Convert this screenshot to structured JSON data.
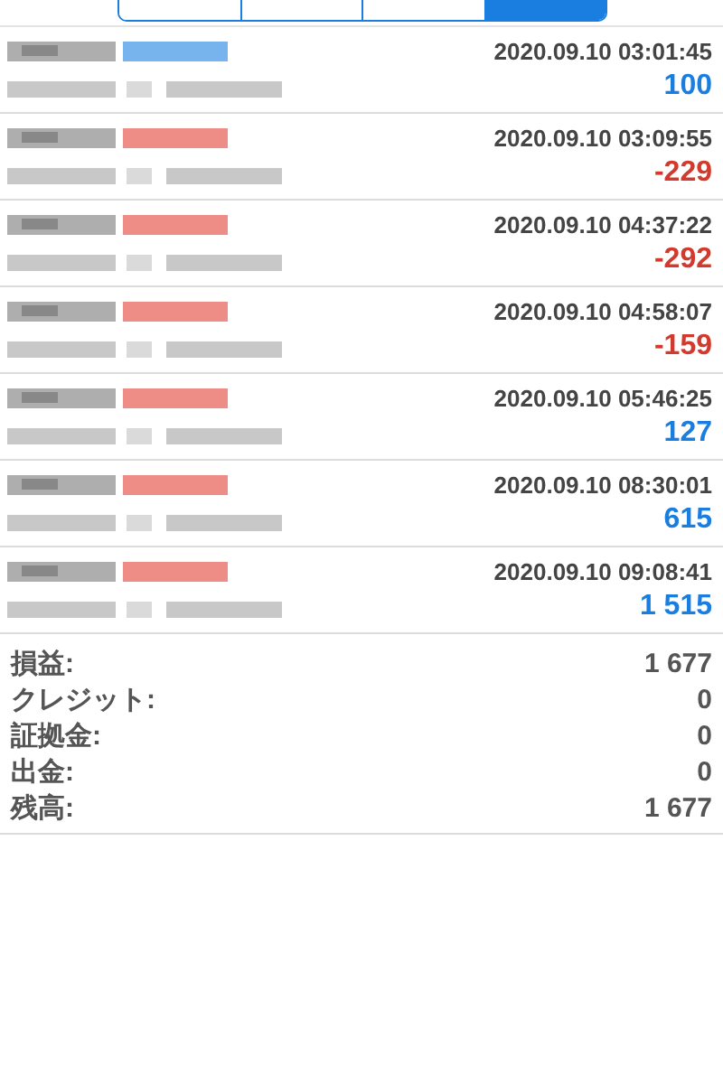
{
  "tabs": [
    {
      "selected": false
    },
    {
      "selected": false
    },
    {
      "selected": false
    },
    {
      "selected": true
    }
  ],
  "deals": [
    {
      "kind": "buy",
      "time": "2020.09.10 03:01:45",
      "profit": "100",
      "positive": true
    },
    {
      "kind": "sell",
      "time": "2020.09.10 03:09:55",
      "profit": "-229",
      "positive": false
    },
    {
      "kind": "sell",
      "time": "2020.09.10 04:37:22",
      "profit": "-292",
      "positive": false
    },
    {
      "kind": "sell",
      "time": "2020.09.10 04:58:07",
      "profit": "-159",
      "positive": false
    },
    {
      "kind": "sell",
      "time": "2020.09.10 05:46:25",
      "profit": "127",
      "positive": true
    },
    {
      "kind": "sell",
      "time": "2020.09.10 08:30:01",
      "profit": "615",
      "positive": true
    },
    {
      "kind": "sell",
      "time": "2020.09.10 09:08:41",
      "profit": "1 515",
      "positive": true
    }
  ],
  "summary": [
    {
      "label": "損益:",
      "value": "1 677"
    },
    {
      "label": "クレジット:",
      "value": "0"
    },
    {
      "label": "証拠金:",
      "value": "0"
    },
    {
      "label": "出金:",
      "value": "0"
    },
    {
      "label": "残高:",
      "value": "1 677"
    }
  ]
}
